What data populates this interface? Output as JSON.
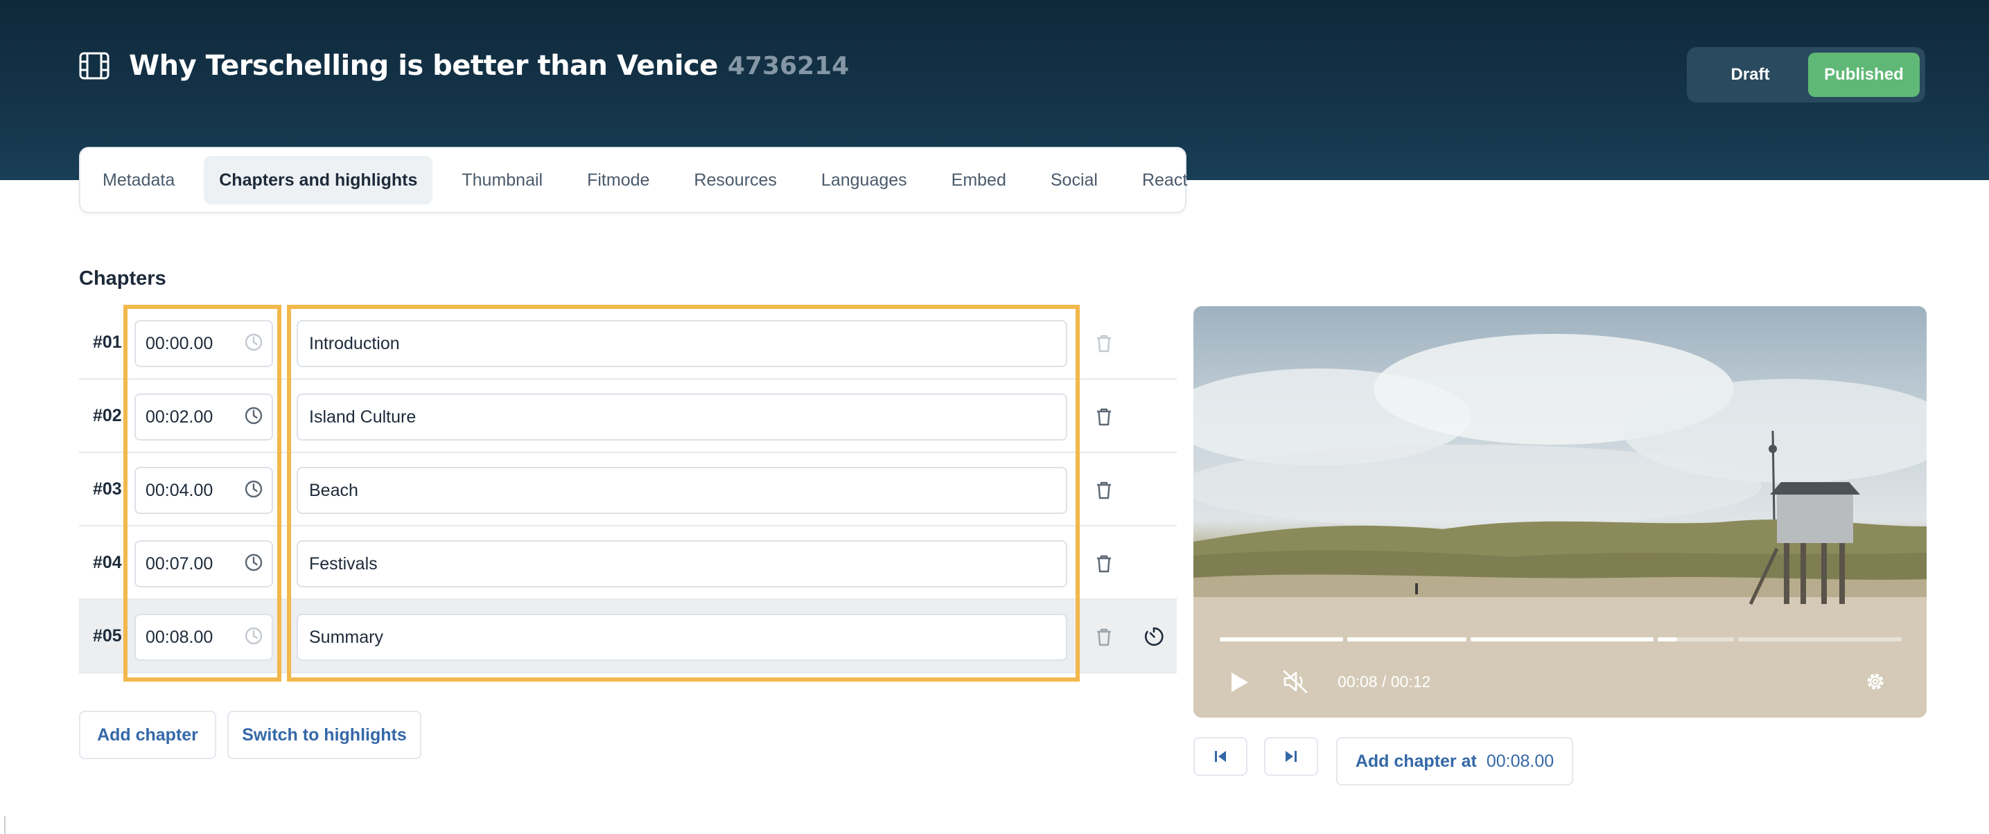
{
  "header": {
    "title": "Why Terschelling is better than Venice",
    "id": "4736214",
    "icon": "film-icon",
    "status_options": [
      {
        "label": "Draft",
        "active": false
      },
      {
        "label": "Published",
        "active": true
      }
    ]
  },
  "tabs": [
    {
      "label": "Metadata",
      "active": false
    },
    {
      "label": "Chapters and highlights",
      "active": true
    },
    {
      "label": "Thumbnail",
      "active": false
    },
    {
      "label": "Fitmode",
      "active": false
    },
    {
      "label": "Resources",
      "active": false
    },
    {
      "label": "Languages",
      "active": false
    },
    {
      "label": "Embed",
      "active": false
    },
    {
      "label": "Social",
      "active": false
    },
    {
      "label": "React",
      "active": false
    }
  ],
  "chapters_section": {
    "title": "Chapters",
    "items": [
      {
        "number": "#01",
        "time": "00:00.00",
        "name": "Introduction"
      },
      {
        "number": "#02",
        "time": "00:02.00",
        "name": "Island Culture"
      },
      {
        "number": "#03",
        "time": "00:04.00",
        "name": "Beach"
      },
      {
        "number": "#04",
        "time": "00:07.00",
        "name": "Festivals"
      },
      {
        "number": "#05",
        "time": "00:08.00",
        "name": "Summary"
      }
    ],
    "add_chapter_label": "Add chapter",
    "switch_label": "Switch to highlights"
  },
  "player": {
    "time_display": "00:08 / 00:12",
    "current_seconds": 8,
    "duration_seconds": 12,
    "muted": true
  },
  "player_actions": {
    "add_chapter_at_label": "Add chapter at",
    "add_chapter_at_time": "00:08.00"
  },
  "colors": {
    "header_bg": "#14344a",
    "published": "#5fb876",
    "highlight": "#f2b84b",
    "link": "#3568a8"
  }
}
